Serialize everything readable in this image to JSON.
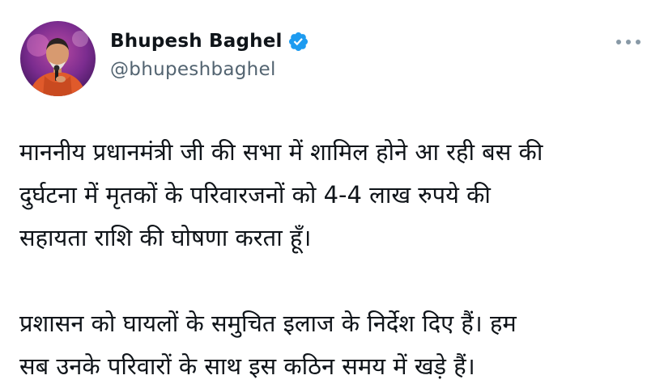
{
  "author": {
    "display_name": "Bhupesh Baghel",
    "handle": "@bhupeshbaghel",
    "verified": true,
    "verified_icon": "verified-badge-icon",
    "verified_color": "#1d9bf0"
  },
  "actions": {
    "more_icon": "more-horizontal-icon"
  },
  "tweet": {
    "paragraphs": [
      "माननीय प्रधानमंत्री जी की सभा में शामिल होने आ रही बस की\nदुर्घटना में मृतकों के परिवारजनों को 4-4 लाख रुपये की\nसहायता राशि की घोषणा करता हूँ।",
      "प्रशासन को घायलों के समुचित इलाज के निर्देश दिए हैं। हम\nसब उनके परिवारों के साथ इस कठिन समय में खड़े हैं।"
    ]
  },
  "colors": {
    "text": "#0f1419",
    "secondary_text": "#536471",
    "background": "#ffffff"
  }
}
